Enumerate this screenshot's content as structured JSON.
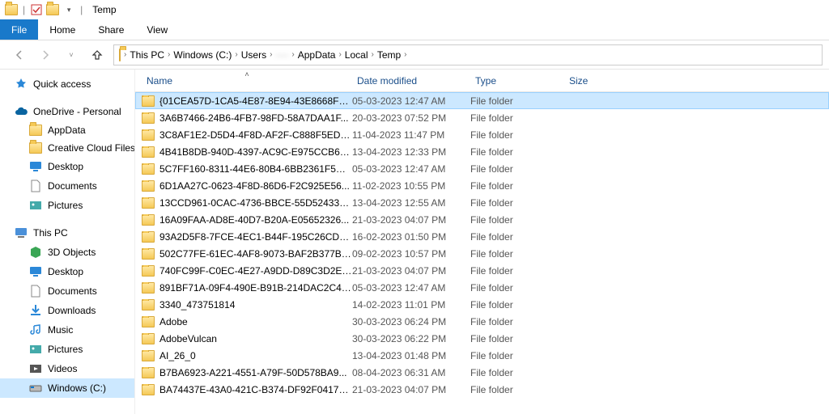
{
  "titlebar": {
    "title": "Temp"
  },
  "ribbon": {
    "file": "File",
    "tabs": [
      "Home",
      "Share",
      "View"
    ]
  },
  "breadcrumb": [
    "This PC",
    "Windows (C:)",
    "Users",
    "····",
    "AppData",
    "Local",
    "Temp"
  ],
  "nav": {
    "quick_access": "Quick access",
    "onedrive": "OneDrive - Personal",
    "onedrive_items": [
      "AppData",
      "Creative Cloud Files",
      "Desktop",
      "Documents",
      "Pictures"
    ],
    "this_pc": "This PC",
    "this_pc_items": [
      "3D Objects",
      "Desktop",
      "Documents",
      "Downloads",
      "Music",
      "Pictures",
      "Videos",
      "Windows (C:)"
    ]
  },
  "columns": {
    "name": "Name",
    "date": "Date modified",
    "type": "Type",
    "size": "Size"
  },
  "rows": [
    {
      "name": "{01CEA57D-1CA5-4E87-8E94-43E8668F9...",
      "date": "05-03-2023 12:47 AM",
      "type": "File folder",
      "selected": true
    },
    {
      "name": "3A6B7466-24B6-4FB7-98FD-58A7DAA1F...",
      "date": "20-03-2023 07:52 PM",
      "type": "File folder"
    },
    {
      "name": "3C8AF1E2-D5D4-4F8D-AF2F-C888F5ED9...",
      "date": "11-04-2023 11:47 PM",
      "type": "File folder"
    },
    {
      "name": "4B41B8DB-940D-4397-AC9C-E975CCB64...",
      "date": "13-04-2023 12:33 PM",
      "type": "File folder"
    },
    {
      "name": "5C7FF160-8311-44E6-80B4-6BB2361F5C27",
      "date": "05-03-2023 12:47 AM",
      "type": "File folder"
    },
    {
      "name": "6D1AA27C-0623-4F8D-86D6-F2C925E56...",
      "date": "11-02-2023 10:55 PM",
      "type": "File folder"
    },
    {
      "name": "13CCD961-0CAC-4736-BBCE-55D52433C...",
      "date": "13-04-2023 12:55 AM",
      "type": "File folder"
    },
    {
      "name": "16A09FAA-AD8E-40D7-B20A-E05652326...",
      "date": "21-03-2023 04:07 PM",
      "type": "File folder"
    },
    {
      "name": "93A2D5F8-7FCE-4EC1-B44F-195C26CDD...",
      "date": "16-02-2023 01:50 PM",
      "type": "File folder"
    },
    {
      "name": "502C77FE-61EC-4AF8-9073-BAF2B377B4...",
      "date": "09-02-2023 10:57 PM",
      "type": "File folder"
    },
    {
      "name": "740FC99F-C0EC-4E27-A9DD-D89C3D2EE...",
      "date": "21-03-2023 04:07 PM",
      "type": "File folder"
    },
    {
      "name": "891BF71A-09F4-490E-B91B-214DAC2C4F...",
      "date": "05-03-2023 12:47 AM",
      "type": "File folder"
    },
    {
      "name": "3340_473751814",
      "date": "14-02-2023 11:01 PM",
      "type": "File folder"
    },
    {
      "name": "Adobe",
      "date": "30-03-2023 06:24 PM",
      "type": "File folder"
    },
    {
      "name": "AdobeVulcan",
      "date": "30-03-2023 06:22 PM",
      "type": "File folder"
    },
    {
      "name": "AI_26_0",
      "date": "13-04-2023 01:48 PM",
      "type": "File folder"
    },
    {
      "name": "B7BA6923-A221-4551-A79F-50D578BA9...",
      "date": "08-04-2023 06:31 AM",
      "type": "File folder"
    },
    {
      "name": "BA74437E-43A0-421C-B374-DF92F04172...",
      "date": "21-03-2023 04:07 PM",
      "type": "File folder"
    }
  ]
}
